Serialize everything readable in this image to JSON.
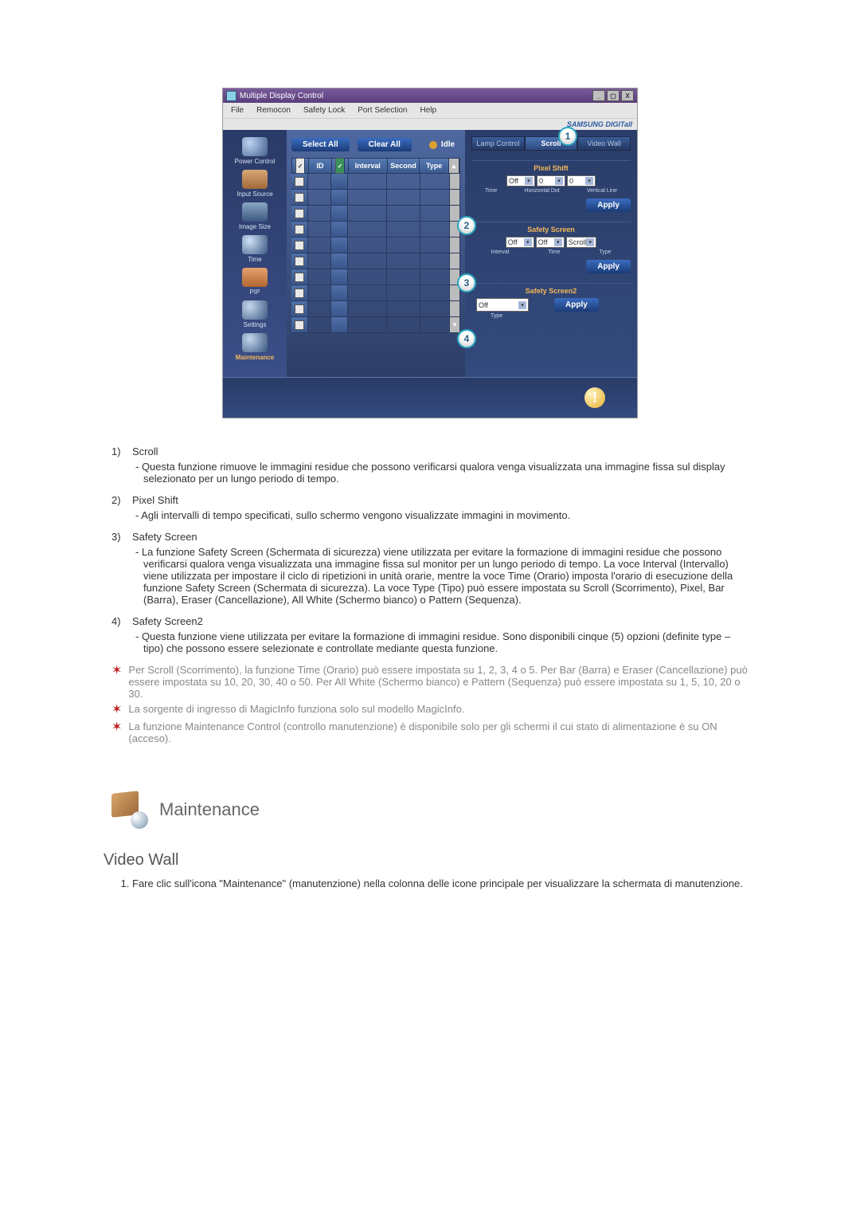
{
  "app": {
    "title": "Multiple Display Control",
    "menu": [
      "File",
      "Remocon",
      "Safety Lock",
      "Port Selection",
      "Help"
    ],
    "brand": "SAMSUNG DIGITall"
  },
  "sidebar": [
    {
      "label": "Power Control",
      "icon": "ic-power"
    },
    {
      "label": "Input Source",
      "icon": "ic-input"
    },
    {
      "label": "Image Size",
      "icon": "ic-image"
    },
    {
      "label": "Time",
      "icon": "ic-time"
    },
    {
      "label": "PIP",
      "icon": "ic-pip"
    },
    {
      "label": "Settings",
      "icon": "ic-settings"
    },
    {
      "label": "Maintenance",
      "icon": "ic-maint",
      "active": true
    }
  ],
  "center": {
    "select_all": "Select All",
    "clear_all": "Clear All",
    "idle": "Idle",
    "cols": {
      "id": "ID",
      "interval": "Interval",
      "second": "Second",
      "type": "Type"
    },
    "rows": 10
  },
  "right": {
    "tabs": [
      "Lamp Control",
      "Scroll",
      "Video Wall"
    ],
    "active_tab": 1,
    "pixel_shift": {
      "title": "Pixel Shift",
      "val1": "Off",
      "val2": "0",
      "val3": "0",
      "labels": [
        "Time",
        "Horizontal Dot",
        "Vertical Line"
      ],
      "apply": "Apply"
    },
    "safety_screen": {
      "title": "Safety Screen",
      "val1": "Off",
      "val2": "Off",
      "val3": "Scroll",
      "labels": [
        "Interval",
        "Time",
        "Type"
      ],
      "apply": "Apply"
    },
    "safety_screen2": {
      "title": "Safety Screen2",
      "val1": "Off",
      "label": "Type",
      "apply": "Apply"
    }
  },
  "markers": [
    "1",
    "2",
    "3",
    "4"
  ],
  "doc": {
    "items": [
      {
        "n": "1)",
        "title": "Scroll",
        "body": "- Questa funzione rimuove le immagini residue che possono verificarsi qualora venga visualizzata una immagine fissa sul display selezionato per un lungo periodo di tempo."
      },
      {
        "n": "2)",
        "title": "Pixel Shift",
        "body": "- Agli intervalli di tempo specificati, sullo schermo vengono visualizzate immagini in movimento."
      },
      {
        "n": "3)",
        "title": "Safety Screen",
        "body": "- La funzione Safety Screen (Schermata di sicurezza) viene utilizzata per evitare la formazione di immagini residue che possono verificarsi qualora venga visualizzata una immagine fissa sul monitor per un lungo periodo di tempo. La voce Interval (Intervallo) viene utilizzata per impostare il ciclo di ripetizioni in unità orarie, mentre la voce Time (Orario) imposta l'orario di esecuzione della funzione Safety Screen (Schermata di sicurezza). La voce Type (Tipo) può essere impostata su Scroll (Scorrimento), Pixel, Bar (Barra), Eraser (Cancellazione), All White (Schermo bianco) o Pattern (Sequenza)."
      },
      {
        "n": "4)",
        "title": "Safety Screen2",
        "body": "- Questa funzione viene utilizzata per evitare la formazione di immagini residue. Sono disponibili cinque (5) opzioni (definite type – tipo) che possono essere selezionate e controllate mediante questa funzione."
      }
    ],
    "stars": [
      "Per Scroll (Scorrimento), la funzione Time (Orario) può essere impostata su 1, 2, 3, 4 o 5. Per Bar (Barra) e Eraser (Cancellazione) può essere impostata su 10, 20, 30, 40 o 50. Per All White (Schermo bianco) e Pattern (Sequenza) può essere impostata su 1, 5, 10, 20 o 30.",
      "La sorgente di ingresso di MagicInfo funziona solo sul modello MagicInfo.",
      "La funzione Maintenance Control (controllo manutenzione) è disponibile solo per gli schermi il cui stato di alimentazione è su ON (acceso)."
    ],
    "section_title": "Maintenance",
    "subsection": "Video Wall",
    "step1": "Fare clic sull'icona \"Maintenance\" (manutenzione) nella colonna delle icone principale per visualizzare la schermata di manutenzione."
  }
}
